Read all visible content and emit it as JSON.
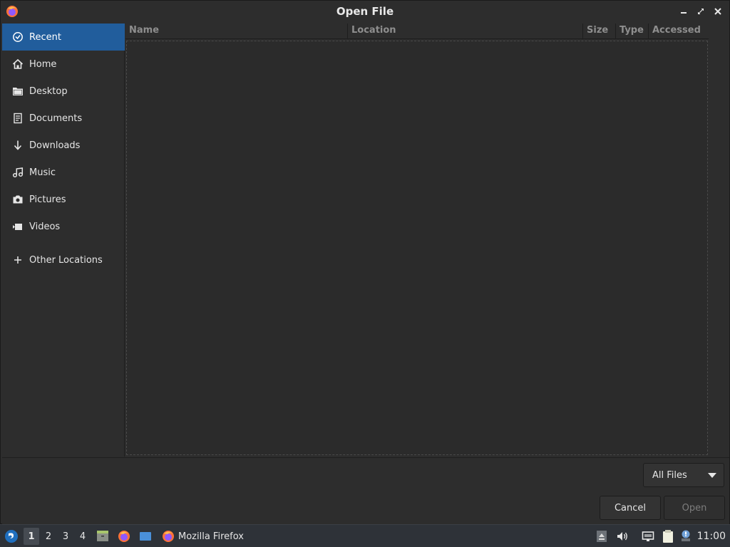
{
  "window": {
    "title": "Open File",
    "app_icon": "firefox-icon",
    "controls": {
      "minimize": "minimize-icon",
      "maximize": "maximize-icon",
      "close": "close-icon"
    }
  },
  "sidebar": {
    "items": [
      {
        "label": "Recent",
        "icon": "clock-icon",
        "active": true
      },
      {
        "label": "Home",
        "icon": "home-icon"
      },
      {
        "label": "Desktop",
        "icon": "folder-icon"
      },
      {
        "label": "Documents",
        "icon": "document-icon"
      },
      {
        "label": "Downloads",
        "icon": "download-icon"
      },
      {
        "label": "Music",
        "icon": "music-icon"
      },
      {
        "label": "Pictures",
        "icon": "camera-icon"
      },
      {
        "label": "Videos",
        "icon": "video-icon"
      },
      {
        "label": "Other Locations",
        "icon": "plus-icon"
      }
    ]
  },
  "file_list": {
    "columns": [
      "Name",
      "Location",
      "Size",
      "Type",
      "Accessed"
    ],
    "rows": []
  },
  "filter": {
    "selected": "All Files"
  },
  "buttons": {
    "cancel": "Cancel",
    "open": "Open"
  },
  "taskbar": {
    "workspaces": [
      "1",
      "2",
      "3",
      "4"
    ],
    "active_workspace": "1",
    "window_label": "Mozilla Firefox",
    "clock": "11:00"
  },
  "colors": {
    "accent": "#215d9c",
    "background": "#2d2d2d",
    "taskbar": "#2e3238"
  }
}
